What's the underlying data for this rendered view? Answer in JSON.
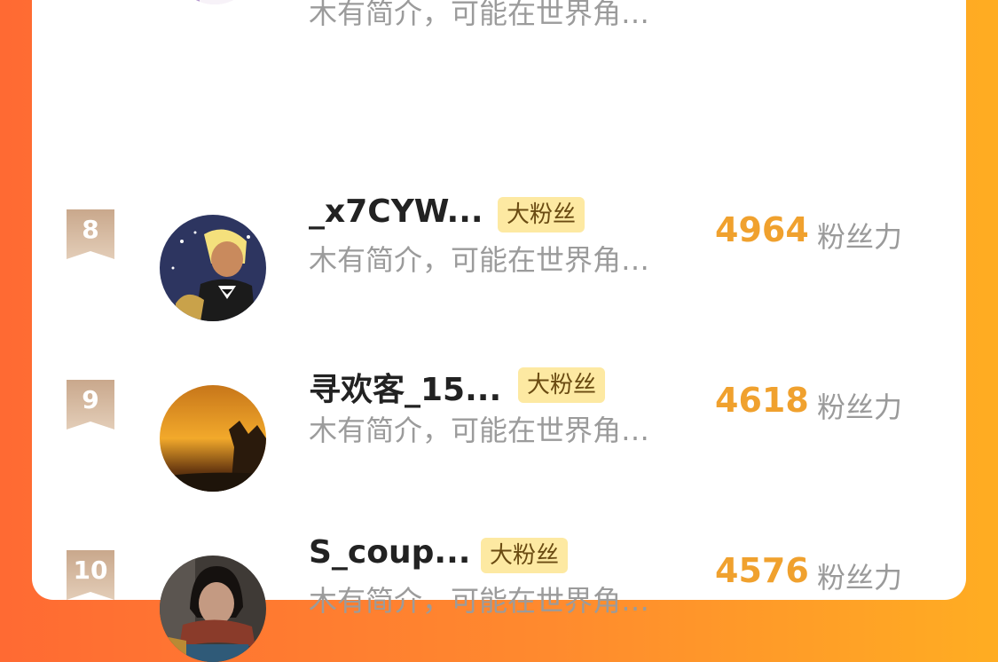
{
  "colors": {
    "background_gradient": [
      "#ff6a33",
      "#ffad22"
    ],
    "card": "#ffffff",
    "score": "#f0a12e",
    "badge_bg": "#fde9a2",
    "badge_text": "#6a4b12",
    "rank_badge": "#d7bba3",
    "name": "#222222",
    "intro": "#9b9b9b"
  },
  "partial_row": {
    "intro": "木有简介，可能在世界角…",
    "avatar_icon": "avatar-cat-icon"
  },
  "rows": [
    {
      "rank": "8",
      "name": "_x7CYW...",
      "badge": "大粉丝",
      "intro": "木有简介，可能在世界角…",
      "score": "4964",
      "unit": "粉丝力",
      "avatar_icon": "avatar-anime-boy-icon"
    },
    {
      "rank": "9",
      "name": "寻欢客_15...",
      "badge": "大粉丝",
      "intro": "木有简介，可能在世界角…",
      "score": "4618",
      "unit": "粉丝力",
      "avatar_icon": "avatar-sunset-icon"
    },
    {
      "rank": "10",
      "name": "S_coup...",
      "badge": "大粉丝",
      "intro": "木有简介，可能在世界角…",
      "score": "4576",
      "unit": "粉丝力",
      "avatar_icon": "avatar-person-scarf-icon"
    }
  ]
}
